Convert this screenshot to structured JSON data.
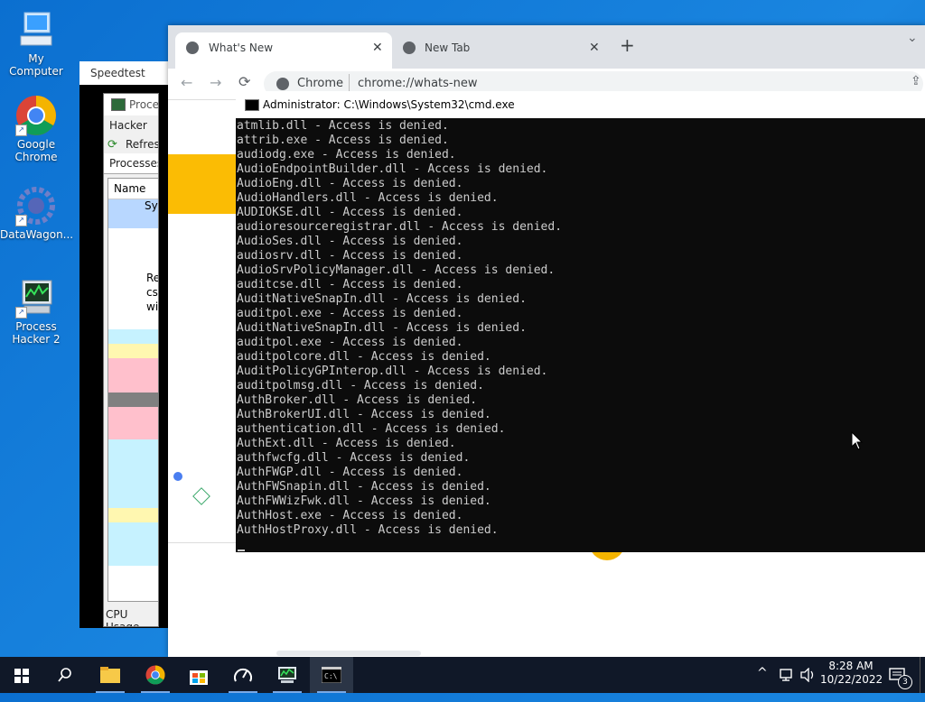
{
  "desktop": {
    "icons": [
      {
        "label": "My Computer"
      },
      {
        "label": "Google Chrome"
      },
      {
        "label": "DataWagon..."
      },
      {
        "label": "Process Hacker 2"
      }
    ]
  },
  "speedtest": {
    "title": "Speedtest"
  },
  "process_hacker": {
    "title": "Proce",
    "menu_item": "Hacker",
    "refresh_label": "Refresh",
    "tab_label": "Processes",
    "column_name": "Name",
    "rows": [
      "Sy",
      "",
      "",
      "",
      "Re",
      "cs",
      "wi",
      "",
      "",
      "",
      "",
      "",
      "",
      "",
      "",
      "",
      "",
      "",
      "",
      "",
      ""
    ],
    "status": "CPU Usage"
  },
  "chrome": {
    "tabs": [
      {
        "label": "What's New"
      },
      {
        "label": "New Tab"
      }
    ],
    "address_site": "Chrome",
    "address_url": "chrome://whats-new"
  },
  "cmd": {
    "title": "Administrator:  C:\\Windows\\System32\\cmd.exe",
    "lines": [
      "atmlib.dll - Access is denied.",
      "attrib.exe - Access is denied.",
      "audiodg.exe - Access is denied.",
      "AudioEndpointBuilder.dll - Access is denied.",
      "AudioEng.dll - Access is denied.",
      "AudioHandlers.dll - Access is denied.",
      "AUDIOKSE.dll - Access is denied.",
      "audioresourceregistrar.dll - Access is denied.",
      "AudioSes.dll - Access is denied.",
      "audiosrv.dll - Access is denied.",
      "AudioSrvPolicyManager.dll - Access is denied.",
      "auditcse.dll - Access is denied.",
      "AuditNativeSnapIn.dll - Access is denied.",
      "auditpol.exe - Access is denied.",
      "AuditNativeSnapIn.dll - Access is denied.",
      "auditpol.exe - Access is denied.",
      "auditpolcore.dll - Access is denied.",
      "AuditPolicyGPInterop.dll - Access is denied.",
      "auditpolmsg.dll - Access is denied.",
      "AuthBroker.dll - Access is denied.",
      "AuthBrokerUI.dll - Access is denied.",
      "authentication.dll - Access is denied.",
      "AuthExt.dll - Access is denied.",
      "authfwcfg.dll - Access is denied.",
      "AuthFWGP.dll - Access is denied.",
      "AuthFWSnapin.dll - Access is denied.",
      "AuthFWWizFwk.dll - Access is denied.",
      "AuthHost.exe - Access is denied.",
      "AuthHostProxy.dll - Access is denied."
    ]
  },
  "taskbar": {
    "time": "8:28 AM",
    "date": "10/22/2022",
    "notification_count": "3"
  }
}
